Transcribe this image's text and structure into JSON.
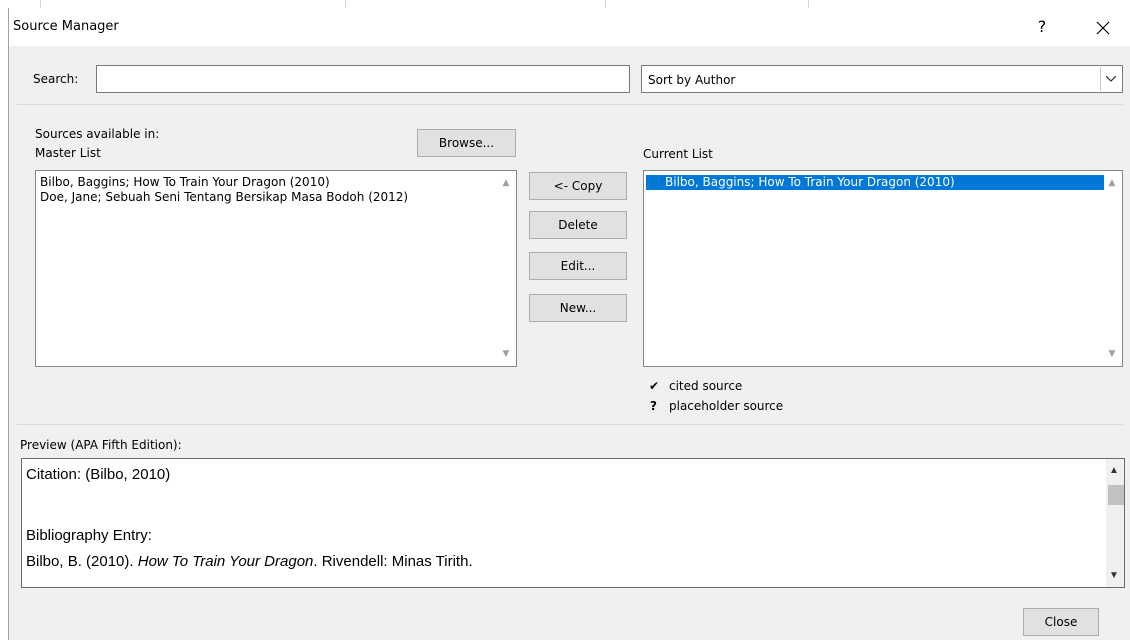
{
  "window": {
    "title": "Source Manager",
    "help_label": "?",
    "close_label": "×"
  },
  "search": {
    "label": "Search:",
    "value": "",
    "placeholder": ""
  },
  "sort": {
    "selected": "Sort by Author"
  },
  "master": {
    "label_line1": "Sources available in:",
    "label_line2": "Master List",
    "browse_label": "Browse...",
    "items": [
      "Bilbo, Baggins; How To Train Your Dragon (2010)",
      "Doe, Jane; Sebuah Seni Tentang Bersikap Masa Bodoh (2012)"
    ]
  },
  "actions": {
    "copy_label": "<- Copy",
    "delete_label": "Delete",
    "edit_label": "Edit...",
    "new_label": "New..."
  },
  "current": {
    "label": "Current List",
    "items": [
      {
        "text": "Bilbo, Baggins; How To Train Your Dragon (2010)",
        "selected": true
      }
    ]
  },
  "legend": {
    "cited_symbol": "✔",
    "cited_label": "cited source",
    "placeholder_symbol": "?",
    "placeholder_label": "placeholder source"
  },
  "preview": {
    "label": "Preview (APA Fifth Edition):",
    "citation": "Citation:  (Bilbo, 2010)",
    "bibliography_heading": "Bibliography Entry:",
    "bib_prefix": "Bilbo, B. (2010). ",
    "bib_title": "How To Train Your Dragon",
    "bib_suffix": ". Rivendell: Minas Tirith."
  },
  "footer": {
    "close_label": "Close"
  },
  "colors": {
    "selection": "#0078d7",
    "dialog_background": "#f0f0f0"
  }
}
